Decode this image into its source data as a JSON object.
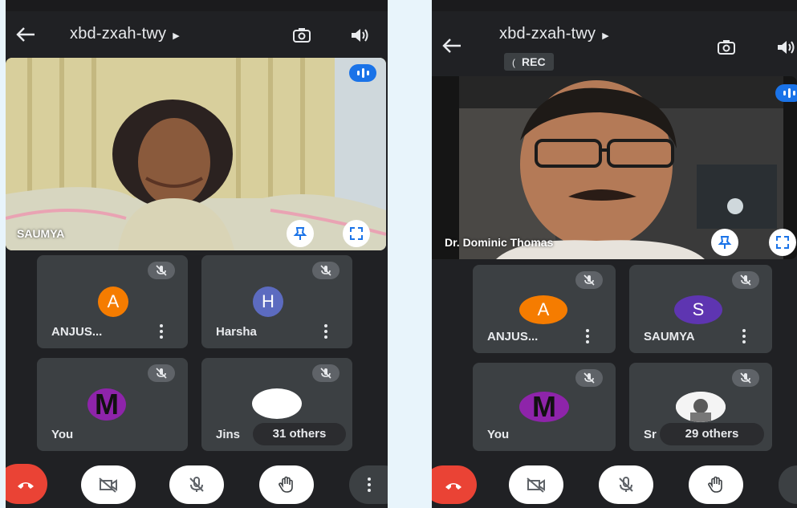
{
  "screens": [
    {
      "meeting_code": "xbd-zxah-twy",
      "active_speaker": "SAUMYA",
      "participants": [
        {
          "initial": "A",
          "name": "ANJUS...",
          "color": "#f57c00"
        },
        {
          "initial": "H",
          "name": "Harsha",
          "color": "#5c6bc0"
        },
        {
          "initial": "M",
          "name": "You",
          "color": "#8e24aa"
        },
        {
          "initial": "",
          "name": "Jins",
          "color": "#ffffff"
        }
      ],
      "others_label": "31 others"
    },
    {
      "meeting_code": "xbd-zxah-twy",
      "recording_label": "REC",
      "active_speaker": "Dr. Dominic Thomas",
      "participants": [
        {
          "initial": "A",
          "name": "ANJUS...",
          "color": "#f57c00"
        },
        {
          "initial": "S",
          "name": "SAUMYA",
          "color": "#5e35b1"
        },
        {
          "initial": "M",
          "name": "You",
          "color": "#8e24aa"
        },
        {
          "initial": "",
          "name": "Sr",
          "color": "#ffffff"
        }
      ],
      "others_label": "29 others"
    }
  ],
  "colors": {
    "call_background": "#202124",
    "tile_background": "#3c4043",
    "end_call_red": "#ea4335",
    "active_blue": "#1a73e8",
    "page_background": "#e8f4fb"
  }
}
